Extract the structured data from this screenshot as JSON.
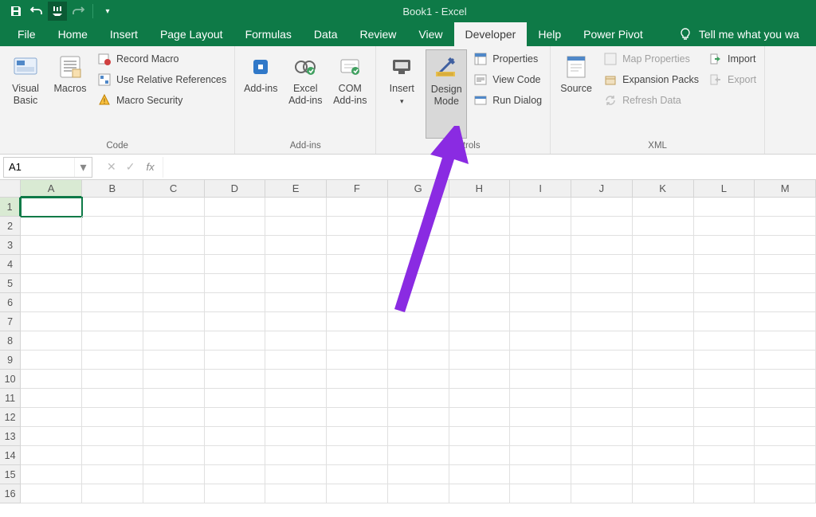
{
  "title": "Book1 - Excel",
  "qat": {
    "save": "save-icon",
    "undo": "undo-icon",
    "touch": "touch-icon",
    "redo": "redo-icon"
  },
  "tabs": [
    "File",
    "Home",
    "Insert",
    "Page Layout",
    "Formulas",
    "Data",
    "Review",
    "View",
    "Developer",
    "Help",
    "Power Pivot"
  ],
  "active_tab": "Developer",
  "tellme": "Tell me what you wa",
  "ribbon": {
    "code": {
      "label": "Code",
      "visual_basic": "Visual Basic",
      "macros": "Macros",
      "record_macro": "Record Macro",
      "use_rel": "Use Relative References",
      "macro_security": "Macro Security"
    },
    "addins": {
      "label": "Add-ins",
      "addins": "Add-ins",
      "excel_addins": "Excel Add-ins",
      "com_addins": "COM Add-ins"
    },
    "controls": {
      "label": "Controls",
      "insert": "Insert",
      "design_mode": "Design Mode",
      "properties": "Properties",
      "view_code": "View Code",
      "run_dialog": "Run Dialog"
    },
    "xml": {
      "label": "XML",
      "source": "Source",
      "map_props": "Map Properties",
      "expansion": "Expansion Packs",
      "refresh": "Refresh Data",
      "import": "Import",
      "export": "Export"
    }
  },
  "formula_bar": {
    "name_box": "A1",
    "fx": "fx"
  },
  "grid": {
    "columns": [
      "A",
      "B",
      "C",
      "D",
      "E",
      "F",
      "G",
      "H",
      "I",
      "J",
      "K",
      "L",
      "M"
    ],
    "rows": [
      1,
      2,
      3,
      4,
      5,
      6,
      7,
      8,
      9,
      10,
      11,
      12,
      13,
      14,
      15,
      16
    ],
    "selected_cell": "A1"
  },
  "annotation": {
    "arrow_color": "#8a2be2"
  }
}
